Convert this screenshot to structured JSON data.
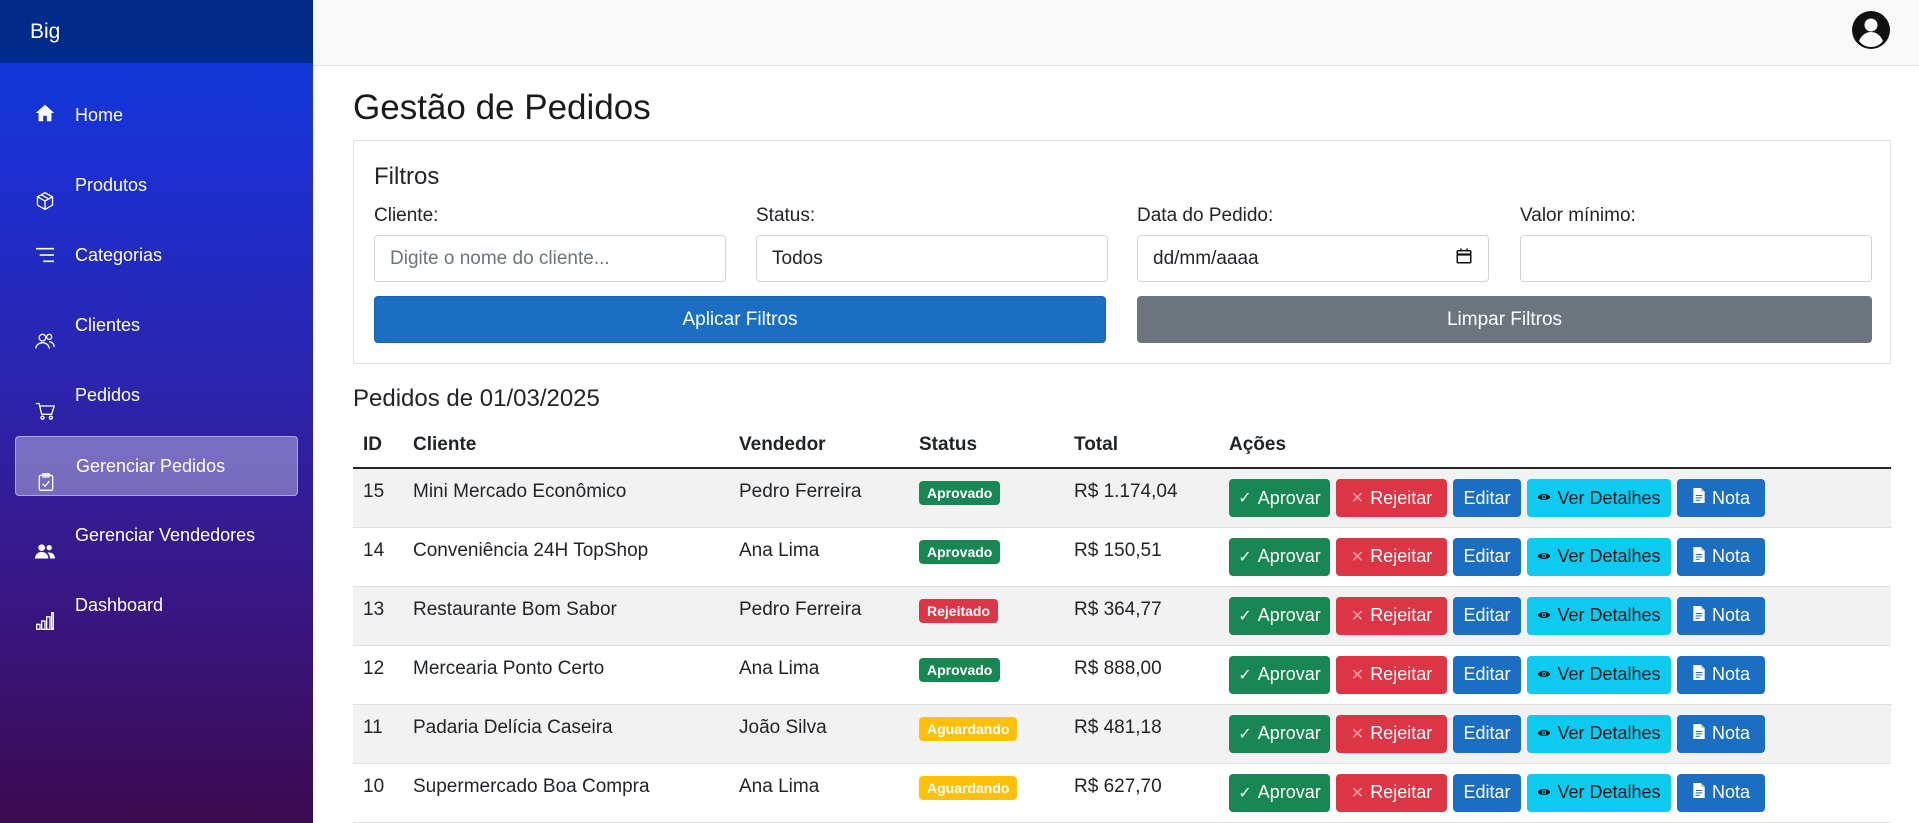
{
  "app": {
    "brand": "Big"
  },
  "sidebar": {
    "items": [
      {
        "label": "Home",
        "icon": "home-icon",
        "active": false
      },
      {
        "label": "Produtos",
        "icon": "box-icon",
        "active": false
      },
      {
        "label": "Categorias",
        "icon": "list-icon",
        "active": false
      },
      {
        "label": "Clientes",
        "icon": "users-icon",
        "active": false
      },
      {
        "label": "Pedidos",
        "icon": "cart-icon",
        "active": false
      },
      {
        "label": "Gerenciar Pedidos",
        "icon": "clipboard-check-icon",
        "active": true
      },
      {
        "label": "Gerenciar Vendedores",
        "icon": "people-icon",
        "active": false
      },
      {
        "label": "Dashboard",
        "icon": "bar-chart-icon",
        "active": false
      }
    ]
  },
  "page": {
    "title": "Gestão de Pedidos"
  },
  "filters": {
    "title": "Filtros",
    "cliente_label": "Cliente:",
    "cliente_placeholder": "Digite o nome do cliente...",
    "status_label": "Status:",
    "status_value": "Todos",
    "data_label": "Data do Pedido:",
    "data_value": "dd/mm/aaaa",
    "valor_label": "Valor mínimo:",
    "valor_value": "",
    "apply_label": "Aplicar Filtros",
    "clear_label": "Limpar Filtros"
  },
  "orders": {
    "title": "Pedidos de 01/03/2025",
    "headers": {
      "id": "ID",
      "cliente": "Cliente",
      "vendedor": "Vendedor",
      "status": "Status",
      "total": "Total",
      "acoes": "Ações"
    },
    "actions": {
      "approve": "Aprovar",
      "reject": "Rejeitar",
      "edit": "Editar",
      "details": "Ver Detalhes",
      "note": "Nota"
    },
    "rows": [
      {
        "id": "15",
        "cliente": "Mini Mercado Econômico",
        "vendedor": "Pedro Ferreira",
        "status": "Aprovado",
        "status_color": "#198754",
        "total": "R$ 1.174,04"
      },
      {
        "id": "14",
        "cliente": "Conveniência 24H TopShop",
        "vendedor": "Ana Lima",
        "status": "Aprovado",
        "status_color": "#198754",
        "total": "R$ 150,51"
      },
      {
        "id": "13",
        "cliente": "Restaurante Bom Sabor",
        "vendedor": "Pedro Ferreira",
        "status": "Rejeitado",
        "status_color": "#dc3545",
        "total": "R$ 364,77"
      },
      {
        "id": "12",
        "cliente": "Mercearia Ponto Certo",
        "vendedor": "Ana Lima",
        "status": "Aprovado",
        "status_color": "#198754",
        "total": "R$ 888,00"
      },
      {
        "id": "11",
        "cliente": "Padaria Delícia Caseira",
        "vendedor": "João Silva",
        "status": "Aguardando",
        "status_color": "#ffc107",
        "total": "R$ 481,18"
      },
      {
        "id": "10",
        "cliente": "Supermercado Boa Compra",
        "vendedor": "Ana Lima",
        "status": "Aguardando",
        "status_color": "#ffc107",
        "total": "R$ 627,70"
      }
    ]
  },
  "colors": {
    "primary": "#1b6ec2",
    "success": "#198754",
    "danger": "#dc3545",
    "info": "#0dcaf0",
    "warning": "#ffc107",
    "secondary": "#6c757d"
  }
}
